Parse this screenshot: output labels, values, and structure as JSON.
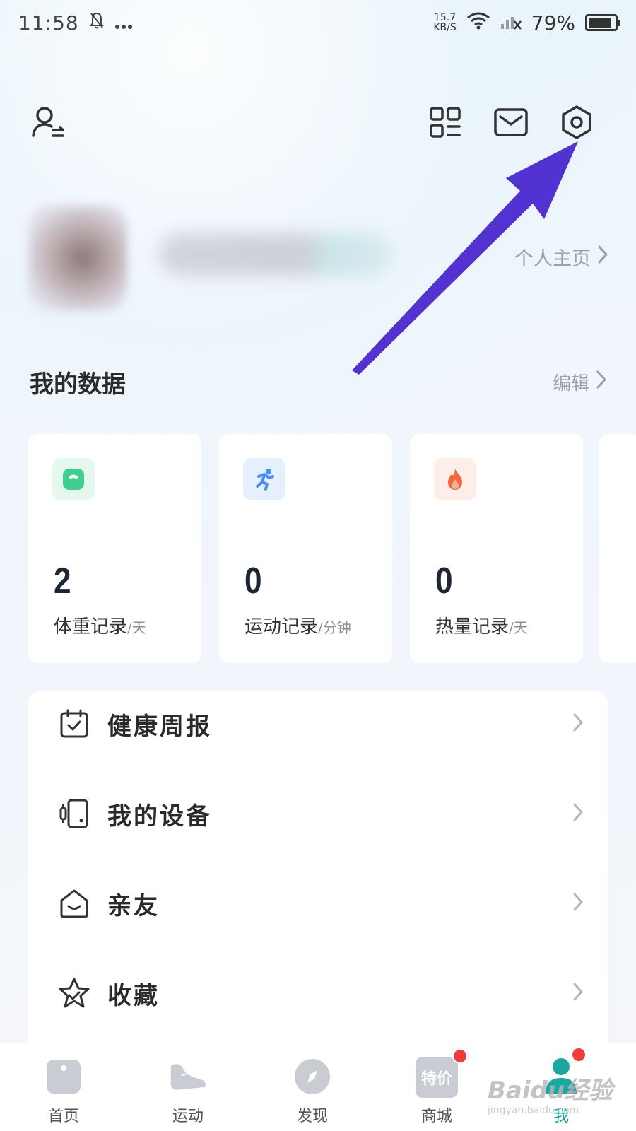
{
  "status_bar": {
    "time": "11:58",
    "net_speed_value": "15.7",
    "net_speed_unit": "KB/S",
    "battery": "79%"
  },
  "profile": {
    "homepage_label": "个人主页"
  },
  "my_data": {
    "title": "我的数据",
    "edit_label": "编辑",
    "cards": [
      {
        "value": "2",
        "label": "体重记录",
        "unit": "/天",
        "icon": "scale-icon",
        "icon_color": "#3ecf8e"
      },
      {
        "value": "0",
        "label": "运动记录",
        "unit": "/分钟",
        "icon": "running-icon",
        "icon_color": "#4b8df8"
      },
      {
        "value": "0",
        "label": "热量记录",
        "unit": "/天",
        "icon": "flame-icon",
        "icon_color": "#f4673b"
      }
    ]
  },
  "menu": {
    "items": [
      {
        "label": "健康周报",
        "icon": "calendar-check-icon"
      },
      {
        "label": "我的设备",
        "icon": "device-icon"
      },
      {
        "label": "亲友",
        "icon": "house-icon"
      },
      {
        "label": "收藏",
        "icon": "star-icon"
      }
    ]
  },
  "tab_bar": {
    "tabs": [
      {
        "label": "首页",
        "icon": "home-icon"
      },
      {
        "label": "运动",
        "icon": "shoe-icon"
      },
      {
        "label": "发现",
        "icon": "compass-icon"
      },
      {
        "label": "商城",
        "icon": "shop-icon",
        "badge_text": "特价"
      },
      {
        "label": "我",
        "icon": "me-icon",
        "active": true
      }
    ]
  },
  "watermark": {
    "text": "Baidu经验",
    "url": "jingyan.baidu.com"
  },
  "colors": {
    "accent_teal": "#1ba6a0",
    "annotation_arrow": "#5232d0",
    "badge_red": "#f43b3b"
  }
}
